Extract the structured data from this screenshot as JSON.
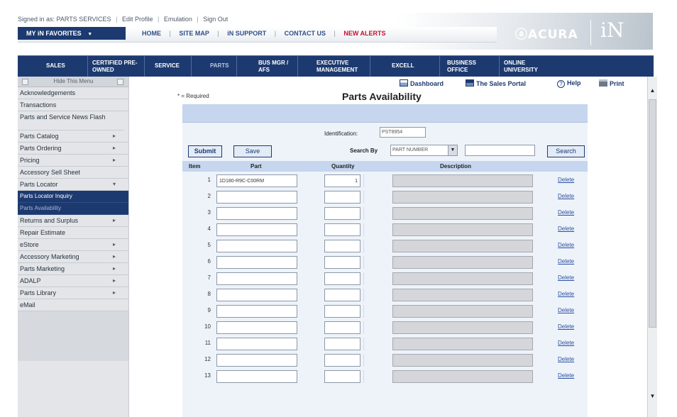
{
  "header": {
    "signed_in": "Signed in as: PARTS SERVICES",
    "edit_profile": "Edit Profile",
    "emulation": "Emulation",
    "sign_out": "Sign Out",
    "favorites": "MY iN FAVORITES",
    "favorites_arrow": "▼",
    "links": [
      "HOME",
      "SITE MAP",
      "iN SUPPORT",
      "CONTACT US",
      "NEW ALERTS"
    ],
    "separator": "|",
    "brand_acura": "ⓐACURA",
    "brand_in": "iN"
  },
  "main_nav": [
    {
      "label": "SALES"
    },
    {
      "label": "CERTIFIED PRE-OWNED"
    },
    {
      "label": "SERVICE"
    },
    {
      "label": "PARTS"
    },
    {
      "label": "BUS MGR / AFS"
    },
    {
      "label": "EXECUTIVE MANAGEMENT"
    },
    {
      "label": "EXCELL"
    },
    {
      "label": "BUSINESS OFFICE"
    },
    {
      "label": "ONLINE UNIVERSITY"
    }
  ],
  "sidebar": {
    "toggle": "Hide This Menu",
    "items": [
      {
        "label": "Acknowledgements",
        "arrow": ""
      },
      {
        "label": "Transactions",
        "arrow": ""
      },
      {
        "label": "Parts and Service News Flash",
        "arrow": ""
      },
      {
        "label": "Parts Catalog",
        "arrow": "▸"
      },
      {
        "label": "Parts Ordering",
        "arrow": "▸"
      },
      {
        "label": "Pricing",
        "arrow": "▸"
      },
      {
        "label": "Accessory Sell Sheet",
        "arrow": ""
      },
      {
        "label": "Parts Locator",
        "arrow": "▾"
      },
      {
        "label": "Parts Locator Inquiry",
        "arrow": ""
      },
      {
        "label": "Parts Availability",
        "arrow": ""
      },
      {
        "label": "Returns and Surplus",
        "arrow": "▸"
      },
      {
        "label": "Repair Estimate",
        "arrow": ""
      },
      {
        "label": "eStore",
        "arrow": "▸"
      },
      {
        "label": "Accessory Marketing",
        "arrow": "▸"
      },
      {
        "label": "Parts Marketing",
        "arrow": "▸"
      },
      {
        "label": "ADALP",
        "arrow": "▸"
      },
      {
        "label": "Parts Library",
        "arrow": "▸"
      },
      {
        "label": "eMail",
        "arrow": ""
      }
    ]
  },
  "toolbar": {
    "dashboard": "Dashboard",
    "sales_portal": "The Sales Portal",
    "help": "Help",
    "print": "Print",
    "help_glyph": "?"
  },
  "page": {
    "required_note": "* = Required",
    "title": "Parts Availability"
  },
  "form": {
    "identification_label": "Identification:",
    "identification_value": "PST8954",
    "submit": "Submit",
    "save": "Save",
    "search_by_label": "Search By",
    "search_by_value": "PART NUMBER",
    "search_by_arrow": "▼",
    "search_value": "",
    "search_button": "Search"
  },
  "grid": {
    "columns": {
      "item": "Item",
      "part": "Part",
      "quantity": "Quantity",
      "description": "Description"
    },
    "delete_label": "Delete",
    "rows": [
      {
        "item": "1",
        "part": "1D180-R9C-C00RM",
        "quantity": "1",
        "description": ""
      },
      {
        "item": "2",
        "part": "",
        "quantity": "",
        "description": ""
      },
      {
        "item": "3",
        "part": "",
        "quantity": "",
        "description": ""
      },
      {
        "item": "4",
        "part": "",
        "quantity": "",
        "description": ""
      },
      {
        "item": "5",
        "part": "",
        "quantity": "",
        "description": ""
      },
      {
        "item": "6",
        "part": "",
        "quantity": "",
        "description": ""
      },
      {
        "item": "7",
        "part": "",
        "quantity": "",
        "description": ""
      },
      {
        "item": "8",
        "part": "",
        "quantity": "",
        "description": ""
      },
      {
        "item": "9",
        "part": "",
        "quantity": "",
        "description": ""
      },
      {
        "item": "10",
        "part": "",
        "quantity": "",
        "description": ""
      },
      {
        "item": "11",
        "part": "",
        "quantity": "",
        "description": ""
      },
      {
        "item": "12",
        "part": "",
        "quantity": "",
        "description": ""
      },
      {
        "item": "13",
        "part": "",
        "quantity": "",
        "description": ""
      }
    ]
  },
  "scroll": {
    "up": "▲",
    "down": "▼"
  },
  "colors": {
    "nav_blue": "#1d3a70",
    "alert_red": "#c8102e",
    "grid_header": "#c5d6ee",
    "form_bg": "#eef3fa"
  }
}
